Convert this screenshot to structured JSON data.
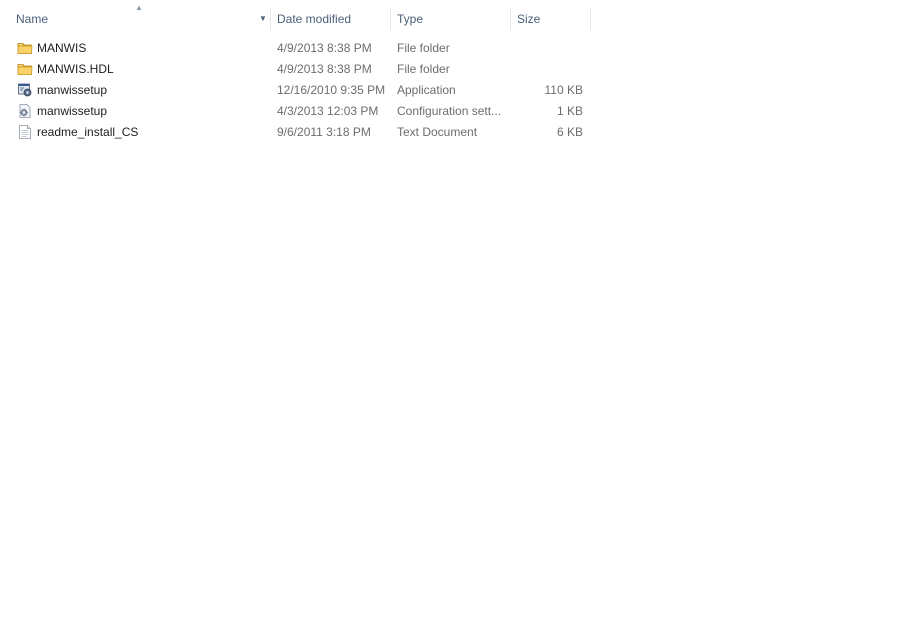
{
  "columns": {
    "name": "Name",
    "date": "Date modified",
    "type": "Type",
    "size": "Size"
  },
  "sort_indicator": "▲",
  "column_dropdown": "▼",
  "rows": [
    {
      "name": "MANWIS",
      "date": "4/9/2013 8:38 PM",
      "type": "File folder",
      "size": "",
      "icon": "folder-icon"
    },
    {
      "name": "MANWIS.HDL",
      "date": "4/9/2013 8:38 PM",
      "type": "File folder",
      "size": "",
      "icon": "folder-icon"
    },
    {
      "name": "manwissetup",
      "date": "12/16/2010 9:35 PM",
      "type": "Application",
      "size": "110 KB",
      "icon": "application-icon"
    },
    {
      "name": "manwissetup",
      "date": "4/3/2013 12:03 PM",
      "type": "Configuration sett...",
      "size": "1 KB",
      "icon": "config-settings-icon"
    },
    {
      "name": "readme_install_CS",
      "date": "9/6/2011 3:18 PM",
      "type": "Text Document",
      "size": "6 KB",
      "icon": "text-document-icon"
    }
  ]
}
